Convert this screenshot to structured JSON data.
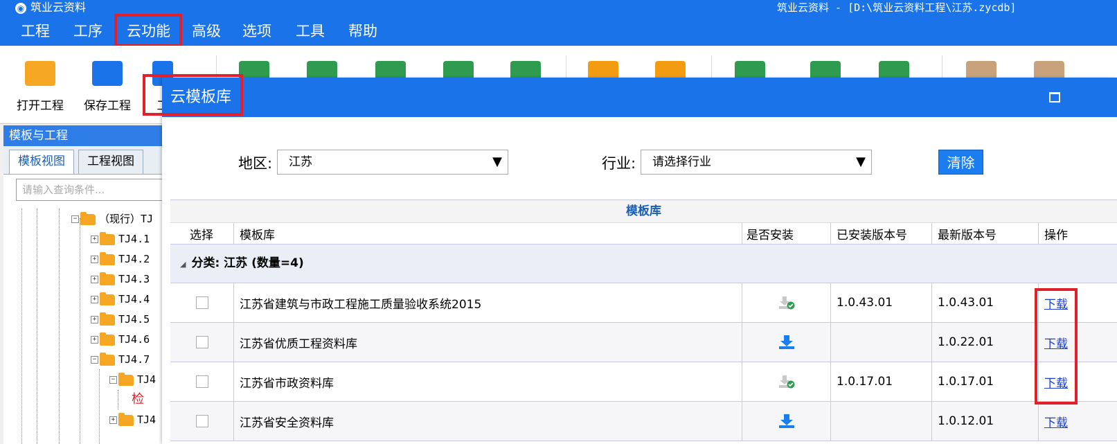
{
  "window": {
    "app_name": "筑业云资料",
    "title": "筑业云资料 - [D:\\筑业云资料工程\\江苏.zycdb]"
  },
  "menu": [
    "工程",
    "工序",
    "云功能",
    "高级",
    "选项",
    "工具",
    "帮助"
  ],
  "toolbar": [
    {
      "label": "打开工程",
      "icon": "folder-open-icon",
      "color": "#f5a623"
    },
    {
      "label": "保存工程",
      "icon": "save-icon",
      "color": "#1a73e8"
    },
    {
      "label": "工",
      "icon": "unknown-icon",
      "color": "#1a73e8"
    },
    {
      "label": "",
      "icon": "trash-icon",
      "color": "#2e9b4f"
    },
    {
      "label": "",
      "icon": "sheet-icon",
      "color": "#2e9b4f"
    },
    {
      "label": "",
      "icon": "list-icon",
      "color": "#2e9b4f"
    },
    {
      "label": "",
      "icon": "table-123-icon",
      "color": "#2e9b4f"
    },
    {
      "label": "",
      "icon": "section-icon",
      "color": "#2e9b4f"
    },
    {
      "label": "",
      "icon": "search-icon",
      "color": "#f39c12"
    },
    {
      "label": "",
      "icon": "undo-icon",
      "color": "#f39c12"
    },
    {
      "label": "",
      "icon": "grid-icon",
      "color": "#2e9b4f"
    },
    {
      "label": "",
      "icon": "preview-icon",
      "color": "#2e9b4f"
    },
    {
      "label": "",
      "icon": "print-icon",
      "color": "#2e9b4f"
    },
    {
      "label": "",
      "icon": "attach-icon",
      "color": "#c8a27a"
    },
    {
      "label": "",
      "icon": "list-alt-icon",
      "color": "#c8a27a"
    }
  ],
  "left_panel": {
    "title": "模板与工程",
    "tabs": [
      "模板视图",
      "工程视图"
    ],
    "search_placeholder": "请输入查询条件...",
    "tree": [
      "（现行）TJ",
      "TJ4.1",
      "TJ4.2",
      "TJ4.3",
      "TJ4.4",
      "TJ4.5",
      "TJ4.6",
      "TJ4.7",
      "TJ4",
      "检",
      "TJ4"
    ]
  },
  "dialog": {
    "title": "云模板库",
    "region_label": "地区:",
    "region_value": "江苏",
    "industry_label": "行业:",
    "industry_placeholder": "请选择行业",
    "clear_button": "清除",
    "grid_caption": "模板库",
    "columns": [
      "选择",
      "模板库",
      "是否安装",
      "已安装版本号",
      "最新版本号",
      "操作"
    ],
    "group_label": "分类: 江苏 (数量=4)",
    "rows": [
      {
        "name": "江苏省建筑与市政工程施工质量验收系统2015",
        "installed": true,
        "installed_version": "1.0.43.01",
        "latest_version": "1.0.43.01",
        "action": "下载"
      },
      {
        "name": "江苏省优质工程资料库",
        "installed": false,
        "installed_version": "",
        "latest_version": "1.0.22.01",
        "action": "下载"
      },
      {
        "name": "江苏省市政资料库",
        "installed": true,
        "installed_version": "1.0.17.01",
        "latest_version": "1.0.17.01",
        "action": "下载"
      },
      {
        "name": "江苏省安全资料库",
        "installed": false,
        "installed_version": "",
        "latest_version": "1.0.12.01",
        "action": "下载"
      }
    ]
  },
  "colors": {
    "accent": "#1a73e8",
    "highlight": "#e0202a",
    "installed_check": "#2e9b4f",
    "download_blue": "#1a7df0"
  }
}
